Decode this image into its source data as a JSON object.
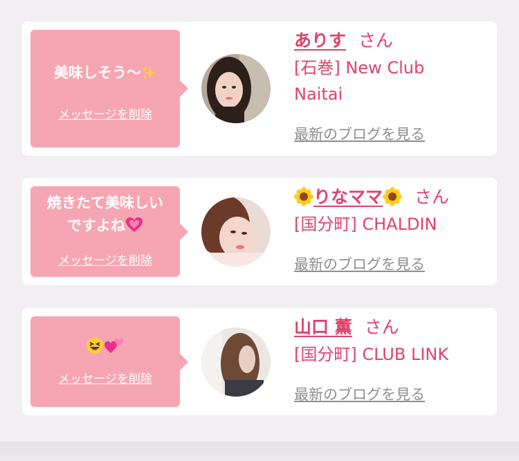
{
  "messages": [
    {
      "bubble_text": "美味しそう〜",
      "bubble_emoji": "sparkles-icon",
      "delete_label": "メッセージを削除",
      "name": "ありす",
      "honorific": "さん",
      "shop_line1": "[石巻] New Club",
      "shop_line2": "Naitai",
      "blog_label": "最新のブログを見る"
    },
    {
      "bubble_line1": "焼きたて美味しい",
      "bubble_line2": "ですよね",
      "bubble_emoji": "growing-heart-icon",
      "delete_label": "メッセージを削除",
      "name": "りなママ",
      "name_emoji": "sunflower-icon",
      "honorific": "さん",
      "shop_line1": "[国分町] CHALDIN",
      "blog_label": "最新のブログを見る"
    },
    {
      "bubble_emoji": "laughing-face-and-two-hearts-icon",
      "delete_label": "メッセージを削除",
      "name": "山口 薫",
      "honorific": "さん",
      "shop_line1": "[国分町] CLUB LINK",
      "blog_label": "最新のブログを見る"
    }
  ],
  "colors": {
    "page_bg": "#f1eff1",
    "card_bg": "#ffffff",
    "bubble_bg": "#f6a6b2",
    "accent": "#e0426a",
    "link_gray": "#8e8e8e"
  }
}
